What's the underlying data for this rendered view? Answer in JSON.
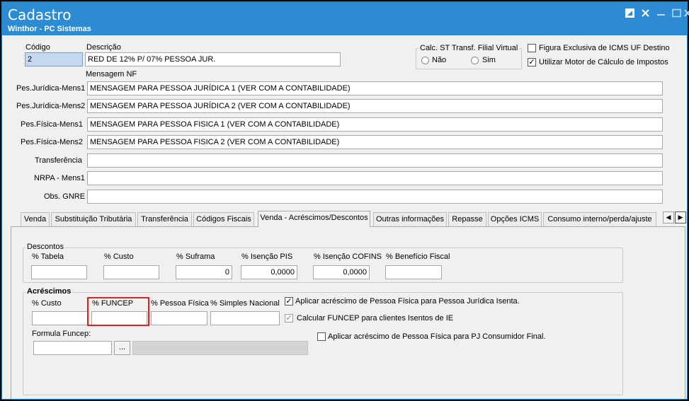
{
  "window": {
    "title": "Cadastro",
    "subtitle": "Winthor - PC Sistemas",
    "controls": [
      "edit-icon",
      "close-icon",
      "minimize-icon",
      "maximize-icon",
      "close-icon"
    ]
  },
  "header": {
    "codigo_label": "Código",
    "codigo_value": "2",
    "descricao_label": "Descrição",
    "descricao_value": "RED DE 12% P/ 07% PESSOA JUR.",
    "calc_st": {
      "title": "Calc. ST Transf. Filial Virtual",
      "options": [
        "Não",
        "Sim"
      ]
    },
    "figura_exclusiva": {
      "label": "Figura Exclusiva de ICMS UF Destino",
      "checked": false
    },
    "utilizar_motor": {
      "label": "Utilizar Motor de Cálculo de Impostos",
      "checked": true
    },
    "mensagem_nf_label": "Mensagem NF",
    "messages": [
      {
        "label": "Pes.Jurídica-Mens1",
        "value": "MENSAGEM PARA PESSOA JURÍDICA 1 (VER COM A CONTABILIDADE)"
      },
      {
        "label": "Pes.Jurídica-Mens2",
        "value": "MENSAGEM PARA PESSOA JURÍDICA 2 (VER COM A CONTABILIDADE)"
      },
      {
        "label": "Pes.Física-Mens1",
        "value": "MENSAGEM PARA PESSOA FISICA 1 (VER COM A CONTABILIDADE)"
      },
      {
        "label": "Pes.Física-Mens2",
        "value": "MENSAGEM PARA PESSOA FISICA 2 (VER COM A CONTABILIDADE)"
      },
      {
        "label": "Transferência",
        "value": ""
      },
      {
        "label": "NRPA - Mens1",
        "value": ""
      },
      {
        "label": "Obs. GNRE",
        "value": ""
      }
    ]
  },
  "tabs": [
    {
      "label": "Venda"
    },
    {
      "label": "Substituição Tributária"
    },
    {
      "label": "Transferência"
    },
    {
      "label": "Códigos Fiscais"
    },
    {
      "label": "Venda - Acréscimos/Descontos",
      "active": true
    },
    {
      "label": "Outras informações"
    },
    {
      "label": "Repasse"
    },
    {
      "label": "Opções ICMS"
    },
    {
      "label": "Consumo interno/perda/ajuste"
    }
  ],
  "descontos": {
    "title": "Descontos",
    "fields": [
      {
        "label": "% Tabela",
        "value": ""
      },
      {
        "label": "% Custo",
        "value": ""
      },
      {
        "label": "% Suframa",
        "value": "0"
      },
      {
        "label": "% Isenção PIS",
        "value": "0,0000"
      },
      {
        "label": "% Isenção COFINS",
        "value": "0,0000"
      },
      {
        "label": "% Benefício Fiscal",
        "value": ""
      }
    ]
  },
  "acrescimos": {
    "title": "Acréscimos",
    "fields": [
      {
        "label": "% Custo",
        "value": ""
      },
      {
        "label": "% FUNCEP",
        "value": ""
      },
      {
        "label": "% Pessoa Física",
        "value": ""
      },
      {
        "label": "% Simples Nacional",
        "value": ""
      }
    ],
    "aplicar_pj_isenta": {
      "label": "Aplicar acréscimo de Pessoa Física para Pessoa Jurídica Isenta.",
      "checked": true
    },
    "calcular_funcep": {
      "label": "Calcular FUNCEP para clientes Isentos de IE",
      "checked": true,
      "disabled": true
    },
    "aplicar_pj_consumidor": {
      "label": "Aplicar acréscimo de Pessoa Física para PJ Consumidor Final.",
      "checked": false
    },
    "formula_label": "Formula Funcep:",
    "formula_value": "",
    "formula_button": "...",
    "formula_desc": ""
  }
}
